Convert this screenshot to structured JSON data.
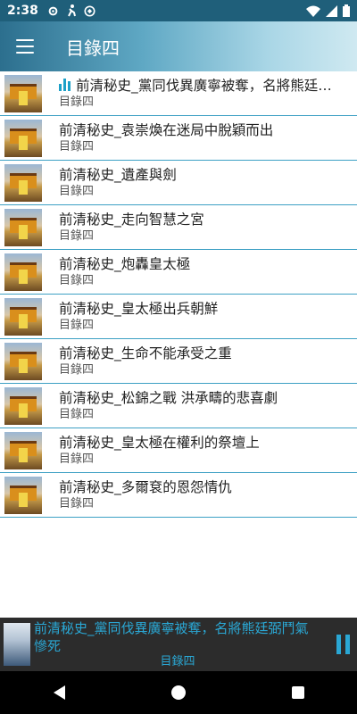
{
  "status": {
    "time": "2:38",
    "icons_left": [
      "gear-icon",
      "accessibility-icon",
      "vpn-icon"
    ],
    "icons_right": [
      "wifi-icon",
      "signal-icon",
      "battery-icon"
    ]
  },
  "app_bar": {
    "title": "目錄四"
  },
  "list": {
    "items": [
      {
        "title": "前清秘史_黨同伐異廣寧被奪，名將熊廷弼鬥氣慘死",
        "subtitle": "目錄四",
        "playing": true
      },
      {
        "title": "前清秘史_袁崇煥在迷局中脫穎而出",
        "subtitle": "目錄四"
      },
      {
        "title": "前清秘史_遺產與劍",
        "subtitle": "目錄四"
      },
      {
        "title": "前清秘史_走向智慧之宮",
        "subtitle": "目錄四"
      },
      {
        "title": "前清秘史_炮轟皇太極",
        "subtitle": "目錄四"
      },
      {
        "title": "前清秘史_皇太極出兵朝鮮",
        "subtitle": "目錄四"
      },
      {
        "title": "前清秘史_生命不能承受之重",
        "subtitle": "目錄四"
      },
      {
        "title": "前清秘史_松錦之戰 洪承疇的悲喜劇",
        "subtitle": "目錄四"
      },
      {
        "title": "前清秘史_皇太極在權利的祭壇上",
        "subtitle": "目錄四"
      },
      {
        "title": "前清秘史_多爾袞的恩怨情仇",
        "subtitle": "目錄四"
      }
    ]
  },
  "now_playing": {
    "title": "前清秘史_黨同伐異廣寧被奪，名將熊廷弼鬥氣慘死",
    "subtitle": "目錄四",
    "accent_color": "#2aa7d4"
  },
  "nav": {
    "icons": [
      "back-icon",
      "home-icon",
      "recents-icon"
    ]
  }
}
